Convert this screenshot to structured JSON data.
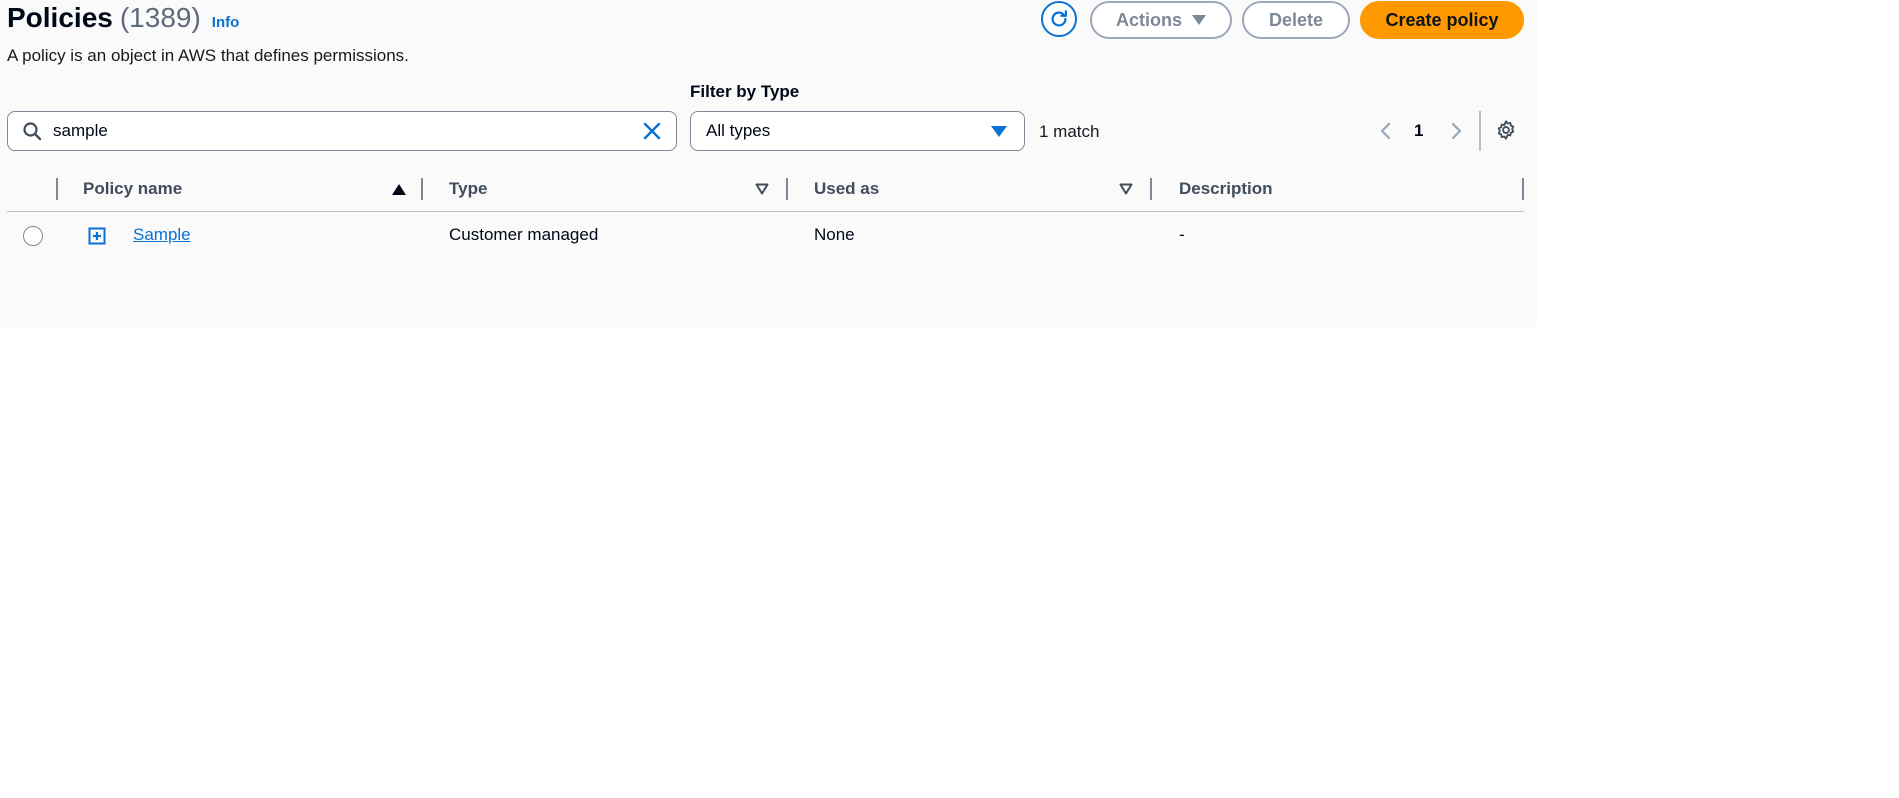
{
  "header": {
    "title": "Policies",
    "count": "(1389)",
    "info_label": "Info",
    "description": "A policy is an object in AWS that defines permissions."
  },
  "toolbar": {
    "refresh_icon": "refresh-icon",
    "actions_label": "Actions",
    "delete_label": "Delete",
    "create_label": "Create policy"
  },
  "search": {
    "value": "sample",
    "icon": "search-icon",
    "clear_icon": "close-icon"
  },
  "filter": {
    "label": "Filter by Type",
    "selected": "All types"
  },
  "results": {
    "match_text": "1 match"
  },
  "pagination": {
    "current_page": "1"
  },
  "table": {
    "columns": [
      {
        "label": "Policy name",
        "sort": "ascending"
      },
      {
        "label": "Type",
        "sort": "filter"
      },
      {
        "label": "Used as",
        "sort": "filter"
      },
      {
        "label": "Description",
        "sort": "none"
      }
    ],
    "rows": [
      {
        "name": "Sample",
        "type": "Customer managed",
        "used_as": "None",
        "description": "-"
      }
    ]
  },
  "colors": {
    "accent": "#0972d3",
    "primary_button": "#ff9900",
    "panel_background": "#fafafa",
    "disabled_border": "#9ba7b6"
  }
}
